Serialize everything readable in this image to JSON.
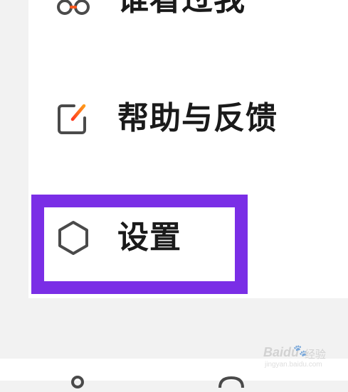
{
  "menu": {
    "items": [
      {
        "id": "visitors",
        "label": "谁看过我",
        "icon": "glasses-icon"
      },
      {
        "id": "help",
        "label": "帮助与反馈",
        "icon": "feedback-edit-icon"
      },
      {
        "id": "settings",
        "label": "设置",
        "icon": "settings-hexagon-icon"
      }
    ]
  },
  "highlight": {
    "target": "settings",
    "color": "#7a2ee6"
  },
  "colors": {
    "accent_start": "#ff3b1f",
    "accent_end": "#ff9a1a",
    "icon_stroke": "#4a4a4a",
    "text": "#1a1a1a"
  },
  "watermark": {
    "brand": "Baidu",
    "word": "经验",
    "url": "jingyan.baidu.com"
  }
}
